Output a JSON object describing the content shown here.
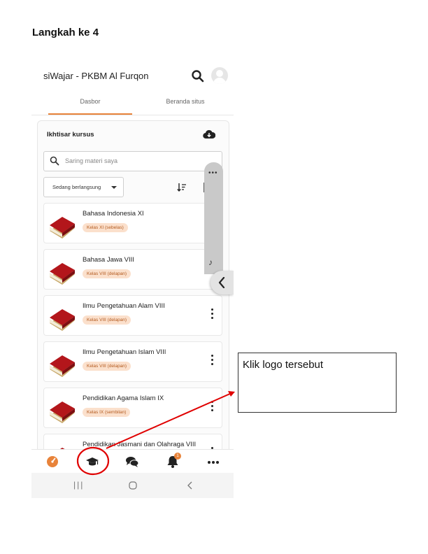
{
  "step_title": "Langkah ke 4",
  "header": {
    "site_name": "siWajar - PKBM Al Furqon"
  },
  "tabs": [
    {
      "label": "Dasbor"
    },
    {
      "label": "Beranda situs"
    }
  ],
  "course_overview": {
    "title": "Ikhtisar kursus",
    "search_placeholder": "Saring materi saya",
    "filter_selected": "Sedang berlangsung"
  },
  "courses": [
    {
      "name": "Bahasa Indonesia XI",
      "category": "Kelas XI (sebelas)"
    },
    {
      "name": "Bahasa Jawa VIII",
      "category": "Kelas VIII (delapan)"
    },
    {
      "name": "Ilmu Pengetahuan Alam VIII",
      "category": "Kelas VIII (delapan)"
    },
    {
      "name": "Ilmu Pengetahuan Islam VIII",
      "category": "Kelas VIII (delapan)"
    },
    {
      "name": "Pendidikan Agama Islam IX",
      "category": "Kelas IX (sembilan)"
    },
    {
      "name": "Pendidikan Jasmani dan Olahraga VIII",
      "category": ""
    }
  ],
  "bottom_nav": {
    "items": [
      "dashboard-icon",
      "graduation-cap-icon",
      "messages-icon",
      "bell-icon",
      "more-icon"
    ],
    "notification_count": "1"
  },
  "callout": {
    "text": "Klik logo tersebut"
  },
  "colors": {
    "accent": "#e8833a",
    "highlight": "#e00000",
    "badge_bg": "#fbe0cc"
  }
}
